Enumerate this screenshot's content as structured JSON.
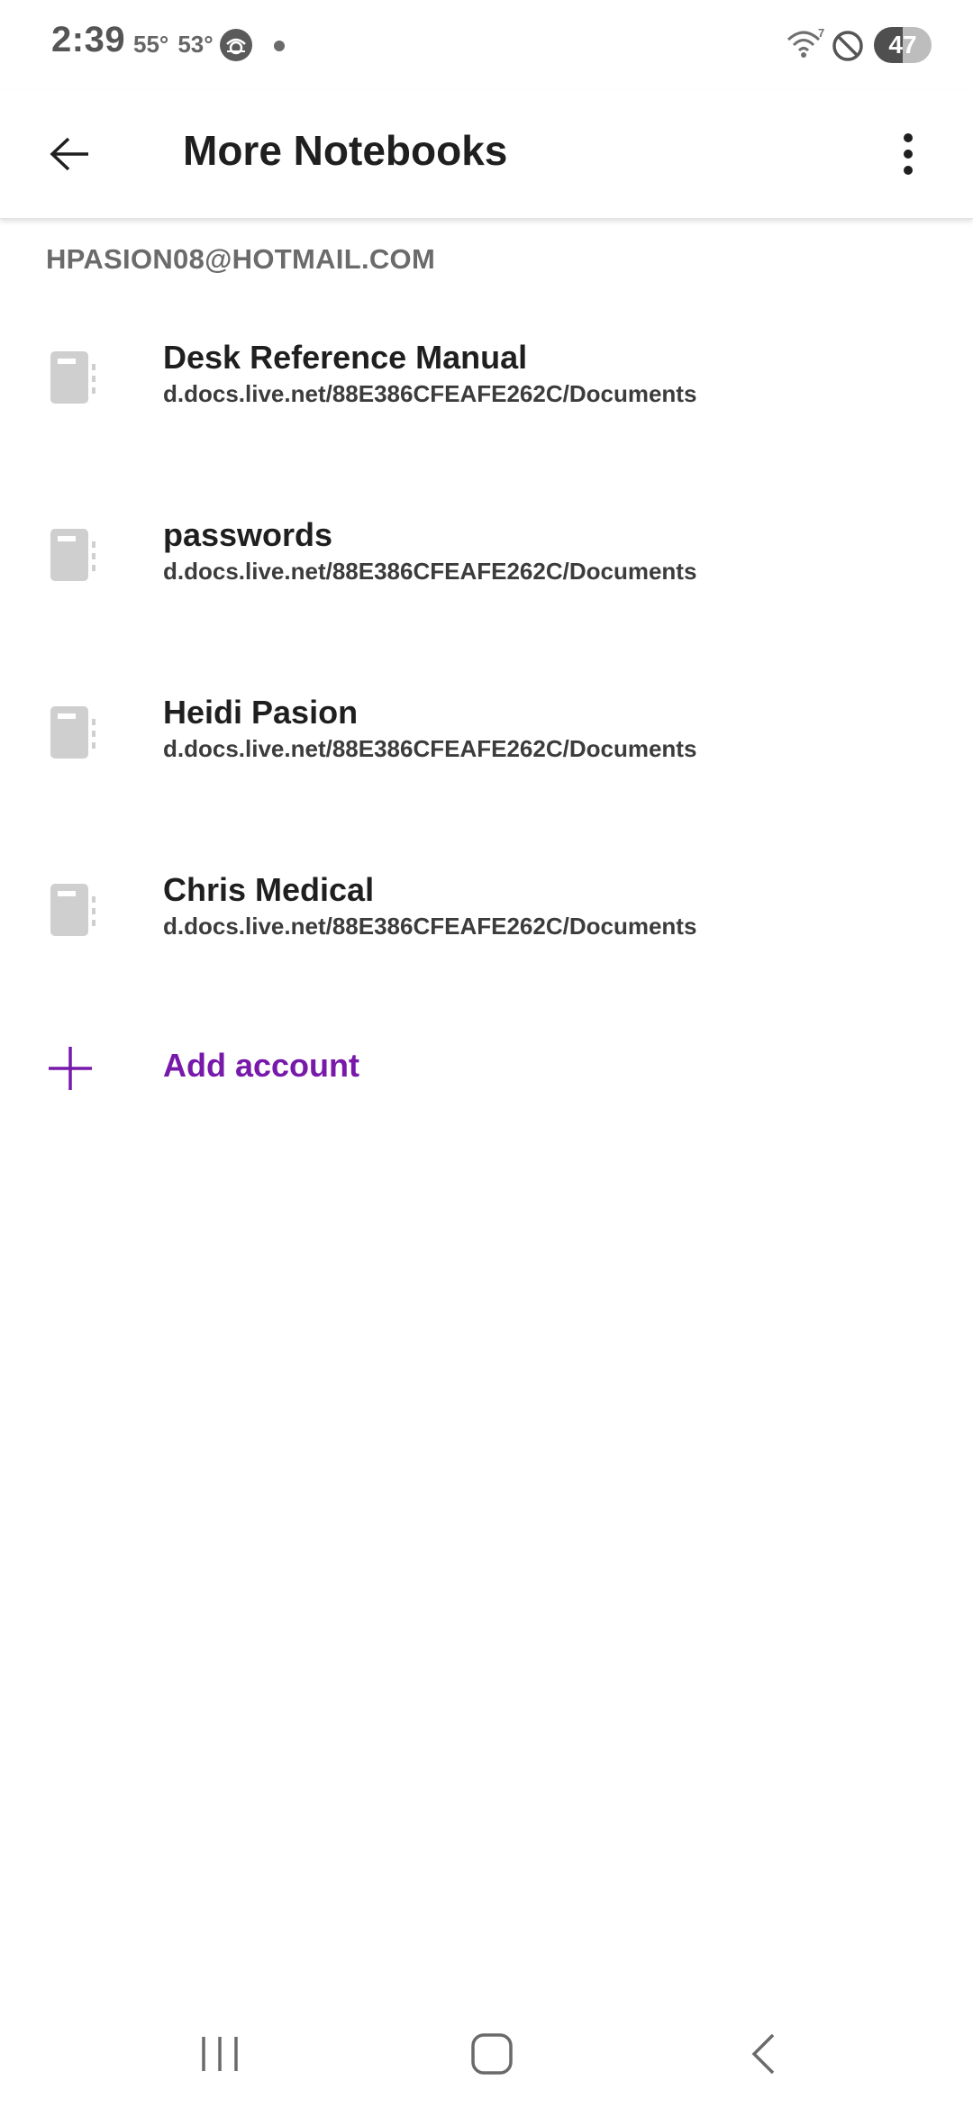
{
  "status_bar": {
    "time": "2:39",
    "temp_current": "55°",
    "temp_low": "53°",
    "weather_icon": "weather-app-icon",
    "wifi_label": "7",
    "battery": "47"
  },
  "app_bar": {
    "title": "More Notebooks",
    "back_icon": "arrow-back-icon",
    "more_icon": "more-vertical-icon"
  },
  "account": {
    "email": "HPASION08@HOTMAIL.COM"
  },
  "notebooks": [
    {
      "name": "Desk Reference Manual",
      "path": "d.docs.live.net/88E386CFEAFE262C/Documents"
    },
    {
      "name": "passwords",
      "path": "d.docs.live.net/88E386CFEAFE262C/Documents"
    },
    {
      "name": "Heidi Pasion",
      "path": "d.docs.live.net/88E386CFEAFE262C/Documents"
    },
    {
      "name": "Chris Medical",
      "path": "d.docs.live.net/88E386CFEAFE262C/Documents"
    }
  ],
  "add_account": {
    "label": "Add account"
  },
  "colors": {
    "accent": "#7719aa",
    "icon_gray": "#cfcfcf",
    "title_text": "#1f1f1f",
    "secondary_text": "#6b6b6b"
  }
}
